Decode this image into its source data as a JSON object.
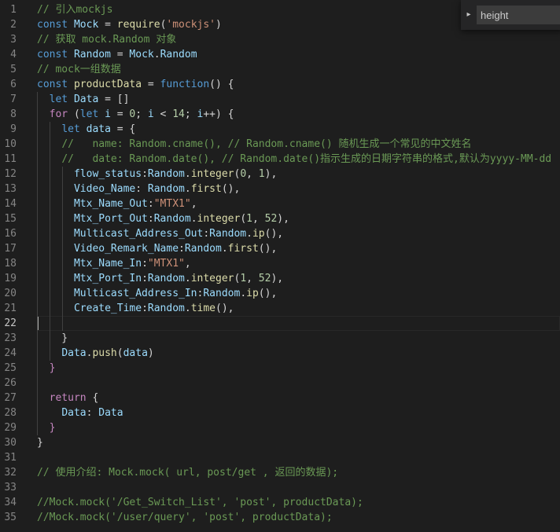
{
  "find_widget": {
    "toggle_icon": "chevron-right-icon",
    "query": "height"
  },
  "editor": {
    "current_line": 22,
    "lines": [
      {
        "n": "1",
        "tokens": [
          [
            "t-com",
            "// 引入mockjs"
          ]
        ]
      },
      {
        "n": "2",
        "tokens": [
          [
            "t-kw",
            "const"
          ],
          [
            "t-pun",
            " "
          ],
          [
            "t-var",
            "Mock"
          ],
          [
            "t-pun",
            " = "
          ],
          [
            "t-fn",
            "require"
          ],
          [
            "t-pun",
            "("
          ],
          [
            "t-str",
            "'mockjs'"
          ],
          [
            "t-pun",
            ")"
          ]
        ]
      },
      {
        "n": "3",
        "tokens": [
          [
            "t-com",
            "// 获取 mock.Random 对象"
          ]
        ]
      },
      {
        "n": "4",
        "tokens": [
          [
            "t-kw",
            "const"
          ],
          [
            "t-pun",
            " "
          ],
          [
            "t-var",
            "Random"
          ],
          [
            "t-pun",
            " = "
          ],
          [
            "t-var",
            "Mock"
          ],
          [
            "t-pun",
            "."
          ],
          [
            "t-var",
            "Random"
          ]
        ]
      },
      {
        "n": "5",
        "tokens": [
          [
            "t-com",
            "// mock一组数据"
          ]
        ]
      },
      {
        "n": "6",
        "tokens": [
          [
            "t-kw",
            "const"
          ],
          [
            "t-pun",
            " "
          ],
          [
            "t-fn",
            "productData"
          ],
          [
            "t-pun",
            " = "
          ],
          [
            "t-kw",
            "function"
          ],
          [
            "t-pun",
            "() {"
          ]
        ]
      },
      {
        "n": "7",
        "tokens": [
          [
            "t-pun",
            "  "
          ],
          [
            "t-kw",
            "let"
          ],
          [
            "t-pun",
            " "
          ],
          [
            "t-var",
            "Data"
          ],
          [
            "t-pun",
            " = []"
          ]
        ]
      },
      {
        "n": "8",
        "tokens": [
          [
            "t-pun",
            "  "
          ],
          [
            "t-ctl",
            "for"
          ],
          [
            "t-pun",
            " ("
          ],
          [
            "t-kw",
            "let"
          ],
          [
            "t-pun",
            " "
          ],
          [
            "t-var",
            "i"
          ],
          [
            "t-pun",
            " = "
          ],
          [
            "t-num",
            "0"
          ],
          [
            "t-pun",
            "; "
          ],
          [
            "t-var",
            "i"
          ],
          [
            "t-pun",
            " < "
          ],
          [
            "t-num",
            "14"
          ],
          [
            "t-pun",
            "; "
          ],
          [
            "t-var",
            "i"
          ],
          [
            "t-pun",
            "++) {"
          ]
        ]
      },
      {
        "n": "9",
        "tokens": [
          [
            "t-pun",
            "    "
          ],
          [
            "t-kw",
            "let"
          ],
          [
            "t-pun",
            " "
          ],
          [
            "t-var",
            "data"
          ],
          [
            "t-pun",
            " = {"
          ]
        ]
      },
      {
        "n": "10",
        "tokens": [
          [
            "t-pun",
            "    "
          ],
          [
            "t-com",
            "//   name: Random.cname(), // Random.cname() 随机生成一个常见的中文姓名"
          ]
        ]
      },
      {
        "n": "11",
        "tokens": [
          [
            "t-pun",
            "    "
          ],
          [
            "t-com",
            "//   date: Random.date(), // Random.date()指示生成的日期字符串的格式,默认为yyyy-MM-dd"
          ]
        ]
      },
      {
        "n": "12",
        "tokens": [
          [
            "t-pun",
            "      "
          ],
          [
            "t-var",
            "flow_status"
          ],
          [
            "t-pun",
            ":"
          ],
          [
            "t-var",
            "Random"
          ],
          [
            "t-pun",
            "."
          ],
          [
            "t-fn",
            "integer"
          ],
          [
            "t-pun",
            "("
          ],
          [
            "t-num",
            "0"
          ],
          [
            "t-pun",
            ", "
          ],
          [
            "t-num",
            "1"
          ],
          [
            "t-pun",
            "),"
          ]
        ]
      },
      {
        "n": "13",
        "tokens": [
          [
            "t-pun",
            "      "
          ],
          [
            "t-var",
            "Video_Name"
          ],
          [
            "t-pun",
            ": "
          ],
          [
            "t-var",
            "Random"
          ],
          [
            "t-pun",
            "."
          ],
          [
            "t-fn",
            "first"
          ],
          [
            "t-pun",
            "(),"
          ]
        ]
      },
      {
        "n": "14",
        "tokens": [
          [
            "t-pun",
            "      "
          ],
          [
            "t-var",
            "Mtx_Name_Out"
          ],
          [
            "t-pun",
            ":"
          ],
          [
            "t-str",
            "\"MTX1\""
          ],
          [
            "t-pun",
            ","
          ]
        ]
      },
      {
        "n": "15",
        "tokens": [
          [
            "t-pun",
            "      "
          ],
          [
            "t-var",
            "Mtx_Port_Out"
          ],
          [
            "t-pun",
            ":"
          ],
          [
            "t-var",
            "Random"
          ],
          [
            "t-pun",
            "."
          ],
          [
            "t-fn",
            "integer"
          ],
          [
            "t-pun",
            "("
          ],
          [
            "t-num",
            "1"
          ],
          [
            "t-pun",
            ", "
          ],
          [
            "t-num",
            "52"
          ],
          [
            "t-pun",
            "),"
          ]
        ]
      },
      {
        "n": "16",
        "tokens": [
          [
            "t-pun",
            "      "
          ],
          [
            "t-var",
            "Multicast_Address_Out"
          ],
          [
            "t-pun",
            ":"
          ],
          [
            "t-var",
            "Random"
          ],
          [
            "t-pun",
            "."
          ],
          [
            "t-fn",
            "ip"
          ],
          [
            "t-pun",
            "(),"
          ]
        ]
      },
      {
        "n": "17",
        "tokens": [
          [
            "t-pun",
            "      "
          ],
          [
            "t-var",
            "Video_Remark_Name"
          ],
          [
            "t-pun",
            ":"
          ],
          [
            "t-var",
            "Random"
          ],
          [
            "t-pun",
            "."
          ],
          [
            "t-fn",
            "first"
          ],
          [
            "t-pun",
            "(),"
          ]
        ]
      },
      {
        "n": "18",
        "tokens": [
          [
            "t-pun",
            "      "
          ],
          [
            "t-var",
            "Mtx_Name_In"
          ],
          [
            "t-pun",
            ":"
          ],
          [
            "t-str",
            "\"MTX1\""
          ],
          [
            "t-pun",
            ","
          ]
        ]
      },
      {
        "n": "19",
        "tokens": [
          [
            "t-pun",
            "      "
          ],
          [
            "t-var",
            "Mtx_Port_In"
          ],
          [
            "t-pun",
            ":"
          ],
          [
            "t-var",
            "Random"
          ],
          [
            "t-pun",
            "."
          ],
          [
            "t-fn",
            "integer"
          ],
          [
            "t-pun",
            "("
          ],
          [
            "t-num",
            "1"
          ],
          [
            "t-pun",
            ", "
          ],
          [
            "t-num",
            "52"
          ],
          [
            "t-pun",
            "),"
          ]
        ]
      },
      {
        "n": "20",
        "tokens": [
          [
            "t-pun",
            "      "
          ],
          [
            "t-var",
            "Multicast_Address_In"
          ],
          [
            "t-pun",
            ":"
          ],
          [
            "t-var",
            "Random"
          ],
          [
            "t-pun",
            "."
          ],
          [
            "t-fn",
            "ip"
          ],
          [
            "t-pun",
            "(),"
          ]
        ]
      },
      {
        "n": "21",
        "tokens": [
          [
            "t-pun",
            "      "
          ],
          [
            "t-var",
            "Create_Time"
          ],
          [
            "t-pun",
            ":"
          ],
          [
            "t-var",
            "Random"
          ],
          [
            "t-pun",
            "."
          ],
          [
            "t-fn",
            "time"
          ],
          [
            "t-pun",
            "(),"
          ]
        ]
      },
      {
        "n": "22",
        "tokens": []
      },
      {
        "n": "23",
        "tokens": [
          [
            "t-pun",
            "    }"
          ]
        ]
      },
      {
        "n": "24",
        "tokens": [
          [
            "t-pun",
            "    "
          ],
          [
            "t-var",
            "Data"
          ],
          [
            "t-pun",
            "."
          ],
          [
            "t-fn",
            "push"
          ],
          [
            "t-pun",
            "("
          ],
          [
            "t-var",
            "data"
          ],
          [
            "t-pun",
            ")"
          ]
        ]
      },
      {
        "n": "25",
        "tokens": [
          [
            "t-ctl",
            "  }"
          ]
        ]
      },
      {
        "n": "26",
        "tokens": []
      },
      {
        "n": "27",
        "tokens": [
          [
            "t-pun",
            "  "
          ],
          [
            "t-ctl",
            "return"
          ],
          [
            "t-pun",
            " {"
          ]
        ]
      },
      {
        "n": "28",
        "tokens": [
          [
            "t-pun",
            "    "
          ],
          [
            "t-var",
            "Data"
          ],
          [
            "t-pun",
            ": "
          ],
          [
            "t-var",
            "Data"
          ]
        ]
      },
      {
        "n": "29",
        "tokens": [
          [
            "t-ctl",
            "  }"
          ]
        ]
      },
      {
        "n": "30",
        "tokens": [
          [
            "t-pun",
            "}"
          ]
        ]
      },
      {
        "n": "31",
        "tokens": []
      },
      {
        "n": "32",
        "tokens": [
          [
            "t-com",
            "// 使用介绍: Mock.mock( url, post/get , 返回的数据);"
          ]
        ]
      },
      {
        "n": "33",
        "tokens": []
      },
      {
        "n": "34",
        "tokens": [
          [
            "t-com",
            "//Mock.mock('/Get_Switch_List', 'post', productData);"
          ]
        ]
      },
      {
        "n": "35",
        "tokens": [
          [
            "t-com",
            "//Mock.mock('/user/query', 'post', productData);"
          ]
        ]
      }
    ]
  }
}
